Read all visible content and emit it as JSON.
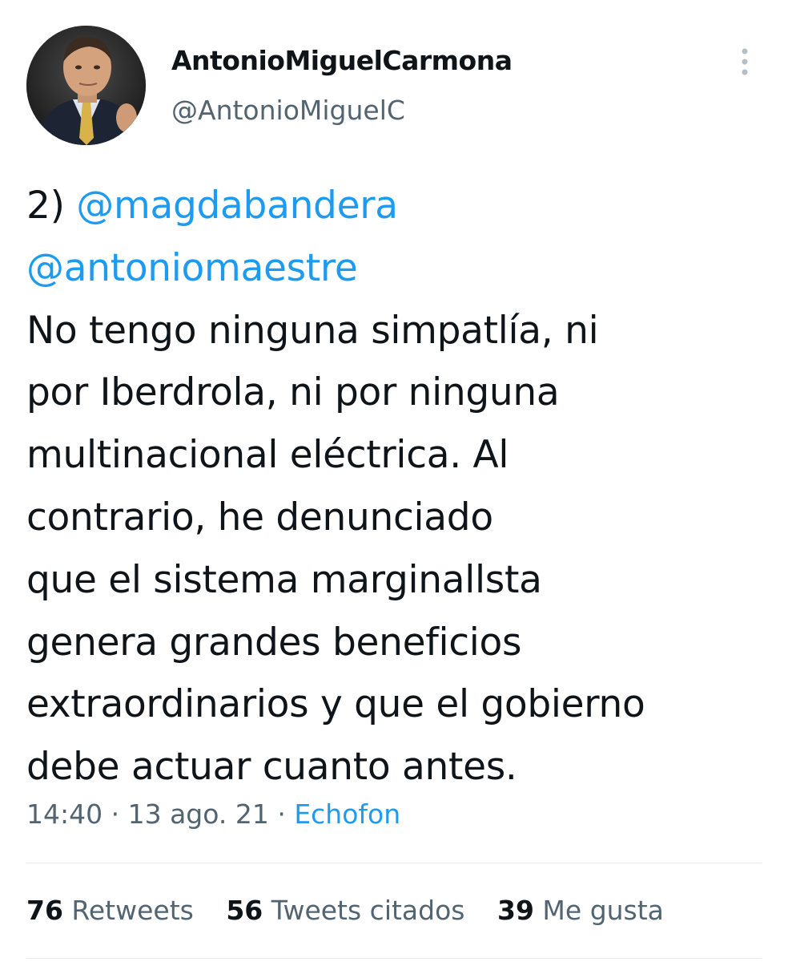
{
  "author": {
    "display_name": "AntonioMiguelCarmona",
    "handle": "@AntonioMiguelC"
  },
  "tweet": {
    "lines": [
      {
        "prefix": "2) ",
        "mention": "@magdabandera"
      },
      {
        "mention": "@antoniomaestre"
      },
      {
        "text": "No tengo ninguna simpatlía, ni"
      },
      {
        "text": "por Iberdrola, ni por ninguna"
      },
      {
        "text": "multinacional eléctrica. Al"
      },
      {
        "text": "contrario, he denunciado"
      },
      {
        "text": "que el sistema marginallsta"
      },
      {
        "text": "genera grandes beneficios"
      },
      {
        "text": "extraordinarios y que el gobierno"
      },
      {
        "text": "debe actuar cuanto antes."
      }
    ]
  },
  "meta": {
    "time": "14:40",
    "separator_1": " · ",
    "date": "13 ago. 21",
    "separator_2": " · ",
    "source": "Echofon"
  },
  "stats": {
    "retweets_count": "76",
    "retweets_label": " Retweets",
    "quotes_count": "56",
    "quotes_label": " Tweets citados",
    "likes_count": "39",
    "likes_label": " Me gusta"
  },
  "icons": {
    "more": "more-vertical-icon"
  },
  "colors": {
    "accent": "#1d9bf0",
    "text": "#0f1419",
    "secondary": "#536471",
    "divider": "#e7ebee"
  }
}
